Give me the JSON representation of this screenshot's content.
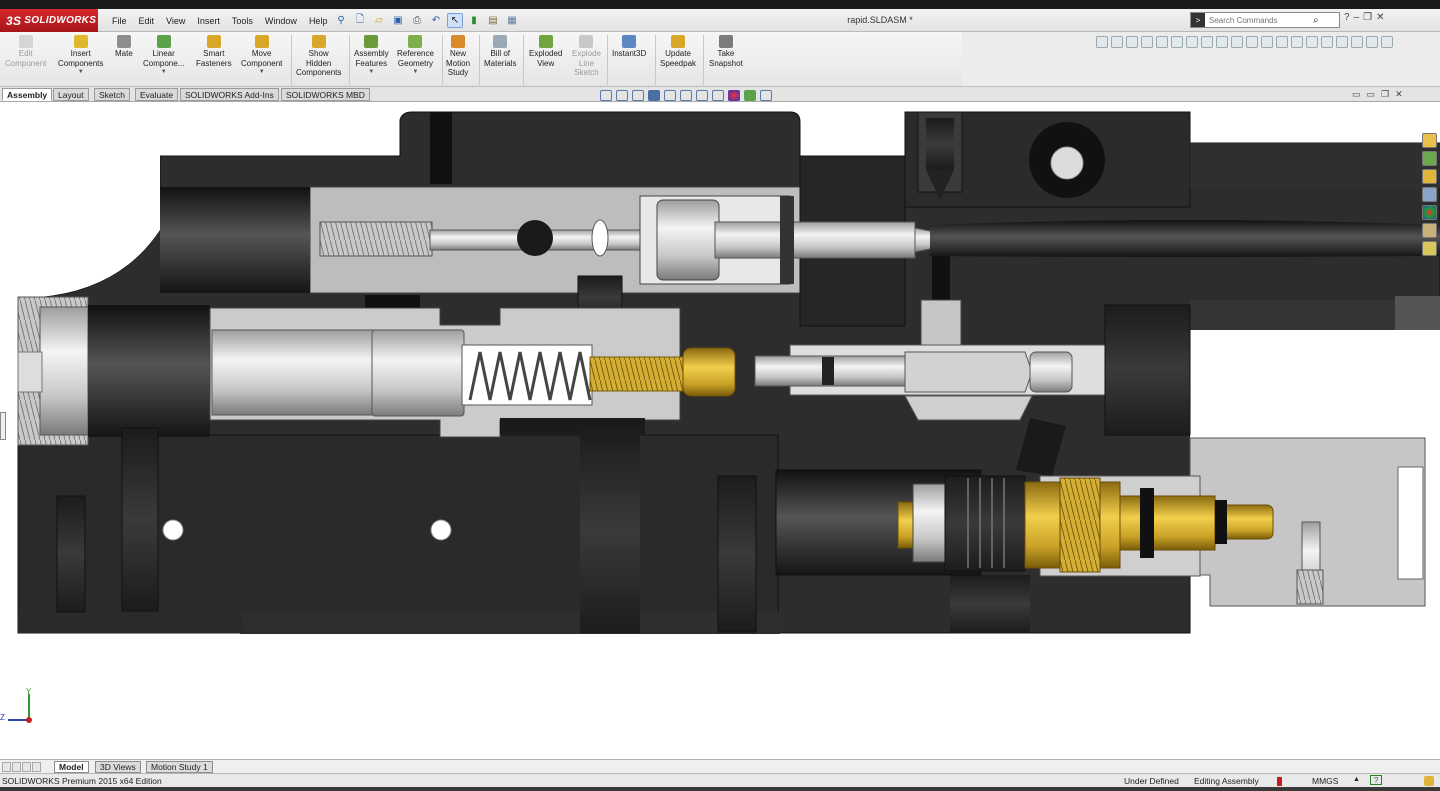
{
  "app": {
    "brand": "SOLIDWORKS",
    "document_title": "rapid.SLDASM *"
  },
  "menu": [
    "File",
    "Edit",
    "View",
    "Insert",
    "Tools",
    "Window",
    "Help"
  ],
  "search": {
    "placeholder": "Search Commands"
  },
  "command_manager": {
    "buttons": [
      {
        "label": "Edit Component",
        "lines": [
          "Edit",
          "Component"
        ],
        "enabled": false
      },
      {
        "label": "Insert Components",
        "lines": [
          "Insert",
          "Components"
        ],
        "enabled": true
      },
      {
        "label": "Mate",
        "lines": [
          "Mate"
        ],
        "enabled": true
      },
      {
        "label": "Linear Compone...",
        "lines": [
          "Linear",
          "Compone..."
        ],
        "enabled": true
      },
      {
        "label": "Smart Fasteners",
        "lines": [
          "Smart",
          "Fasteners"
        ],
        "enabled": true
      },
      {
        "label": "Move Component",
        "lines": [
          "Move",
          "Component"
        ],
        "enabled": true
      },
      {
        "label": "Show Hidden Components",
        "lines": [
          "Show",
          "Hidden",
          "Components"
        ],
        "enabled": true
      },
      {
        "label": "Assembly Features",
        "lines": [
          "Assembly",
          "Features"
        ],
        "enabled": true
      },
      {
        "label": "Reference Geometry",
        "lines": [
          "Reference",
          "Geometry"
        ],
        "enabled": true
      },
      {
        "label": "New Motion Study",
        "lines": [
          "New",
          "Motion",
          "Study"
        ],
        "enabled": true
      },
      {
        "label": "Bill of Materials",
        "lines": [
          "Bill of",
          "Materials"
        ],
        "enabled": true
      },
      {
        "label": "Exploded View",
        "lines": [
          "Exploded",
          "View"
        ],
        "enabled": true
      },
      {
        "label": "Explode Line Sketch",
        "lines": [
          "Explode",
          "Line",
          "Sketch"
        ],
        "enabled": false
      },
      {
        "label": "Instant3D",
        "lines": [
          "Instant3D"
        ],
        "enabled": true
      },
      {
        "label": "Update Speedpak",
        "lines": [
          "Update",
          "Speedpak"
        ],
        "enabled": true
      },
      {
        "label": "Take Snapshot",
        "lines": [
          "Take",
          "Snapshot"
        ],
        "enabled": true
      }
    ],
    "tabs": [
      "Assembly",
      "Layout",
      "Sketch",
      "Evaluate",
      "SOLIDWORKS Add-Ins",
      "SOLIDWORKS MBD"
    ],
    "active_tab": "Assembly"
  },
  "triad": {
    "y_label": "Y",
    "z_label": "Z"
  },
  "model_tabs": [
    "Model",
    "3D Views",
    "Motion Study 1"
  ],
  "status": {
    "edition": "SOLIDWORKS Premium 2015 x64 Edition",
    "definition": "Under Defined",
    "mode": "Editing Assembly",
    "units": "MMGS",
    "units_caret": "▲",
    "help": "?"
  },
  "colors": {
    "brand_red": "#c41e22",
    "body_dark": "#2b2b2b",
    "steel": "#c9c9c9",
    "brass": "#c9a227"
  }
}
